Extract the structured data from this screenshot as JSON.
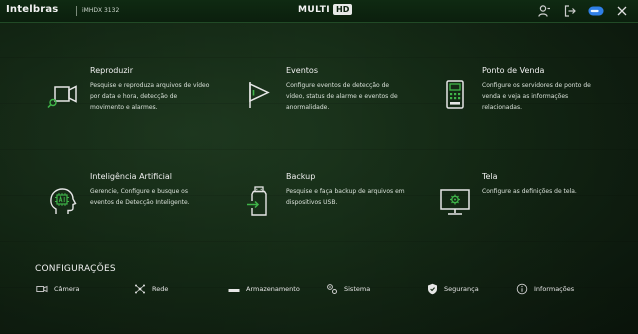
{
  "topbar": {
    "brand": "Intelbras",
    "model": "iMHDX 3132",
    "logo_multi": "MULTI",
    "logo_hd": "HD",
    "icons": [
      {
        "name": "user-icon"
      },
      {
        "name": "logout-icon"
      },
      {
        "name": "toggle-icon"
      },
      {
        "name": "close-icon"
      }
    ]
  },
  "tiles": [
    {
      "title": "Reproduzir",
      "desc": "Pesquise e reproduza arquivos de vídeo por data e hora, detecção de movimento e alarmes.",
      "icon": "playback-icon"
    },
    {
      "title": "Eventos",
      "desc": "Configure eventos de detecção de vídeo, status de alarme e eventos de anormalidade.",
      "icon": "flag-icon"
    },
    {
      "title": "Ponto de Venda",
      "desc": "Configure os servidores de ponto de venda e veja as informações relacionadas.",
      "icon": "pos-terminal-icon"
    },
    {
      "title": "Inteligência Artificial",
      "desc": "Gerencie, Configure e busque os eventos de Detecção Inteligente.",
      "icon": "ai-head-icon"
    },
    {
      "title": "Backup",
      "desc": "Pesquise e faça backup de arquivos em dispositivos USB.",
      "icon": "backup-usb-icon"
    },
    {
      "title": "Tela",
      "desc": "Configure as definições de tela.",
      "icon": "display-settings-icon"
    }
  ],
  "config_section_title": "CONFIGURAÇÕES",
  "config_items": [
    {
      "label": "Câmera",
      "icon": "camera-icon"
    },
    {
      "label": "Rede",
      "icon": "network-icon"
    },
    {
      "label": "Armazenamento",
      "icon": "storage-icon"
    },
    {
      "label": "Sistema",
      "icon": "system-icon"
    },
    {
      "label": "Segurança",
      "icon": "shield-icon"
    },
    {
      "label": "Informações",
      "icon": "info-icon"
    }
  ],
  "colors": {
    "accent": "#3fb449",
    "background_dark": "#0b160c",
    "topbar": "#0f2a12",
    "toggle_blue": "#2f7fe8"
  }
}
